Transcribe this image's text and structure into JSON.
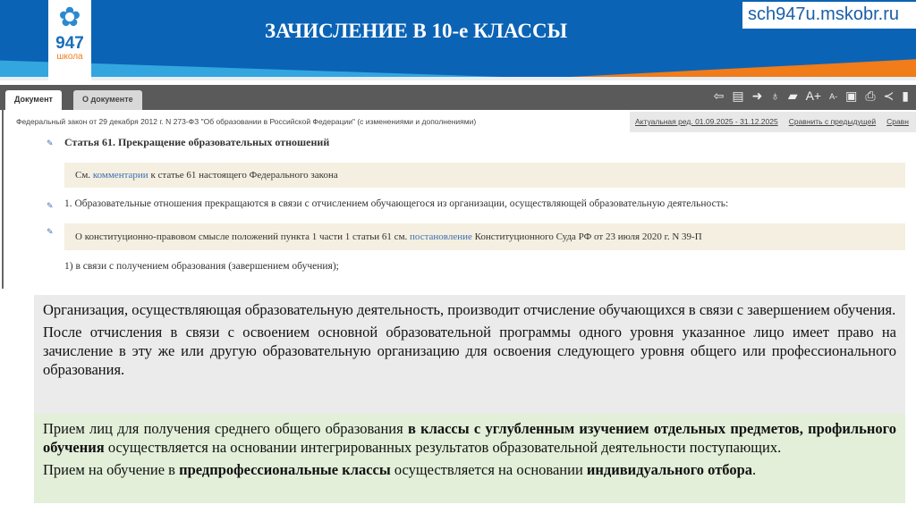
{
  "header": {
    "title": "ЗАЧИСЛЕНИЕ В 10-е КЛАССЫ",
    "url": "sch947u.mskobr.ru",
    "logo": {
      "number": "947",
      "word": "школа"
    }
  },
  "tabs": [
    {
      "label": "Документ"
    },
    {
      "label": "О документе"
    }
  ],
  "toolbar": {
    "icons": [
      "arrow-left-icon",
      "document-icon",
      "arrow-right-icon",
      "lightbulb-icon",
      "speech-icon",
      "font-increase-icon",
      "font-decrease-icon",
      "save-icon",
      "print-icon",
      "share-icon",
      "bookmark-icon"
    ],
    "font_up": "A+",
    "font_down": "A-"
  },
  "doc_info": {
    "title": "Федеральный закон от 29 декабря 2012 г. N 273-ФЗ \"Об образовании в Российской Федерации\" (с изменениями и дополнениями)",
    "edition": "Актуальная ред. 01.09.2025 - 31.12.2025",
    "compare_prev": "Сравнить с предыдущей",
    "compare_more": "Сравн"
  },
  "document": {
    "article": "Статья 61. Прекращение образовательных отношений",
    "note1": {
      "pre": "См. ",
      "link": "комментарии",
      "post": " к статье 61 настоящего Федерального закона"
    },
    "p1": "1. Образовательные отношения прекращаются в связи с отчислением обучающегося из организации, осуществляющей образовательную деятельность:",
    "note2": {
      "pre": "О конституционно-правовом смысле положений пункта 1 части 1 статьи 61 см. ",
      "link": "постановление",
      "post": " Конституционного Суда РФ от 23 июля 2020 г. N 39-П"
    },
    "item1": "1) в связи с получением образования (завершением обучения);"
  },
  "panel": {
    "gray": [
      "Организация, осуществляющая образовательную деятельность, производит отчисление обучающихся в связи с завершением обучения.",
      "После отчисления в связи с освоением основной образовательной программы одного уровня указанное лицо имеет право на зачисление в эту же или другую образовательную организацию для освоения следующего уровня общего или профессионального образования."
    ],
    "green1": {
      "a": "Прием лиц для получения среднего общего образования ",
      "b": "в классы с углубленным изучением отдельных предметов, профильного обучения",
      "c": " осуществляется на основании интегрированных результатов образовательной деятельности поступающих."
    },
    "green2": {
      "a": "Прием на обучение в ",
      "b": "предпрофессиональные классы",
      "c": " осуществляется на основании ",
      "d": "индивидуального отбора",
      "e": "."
    }
  }
}
